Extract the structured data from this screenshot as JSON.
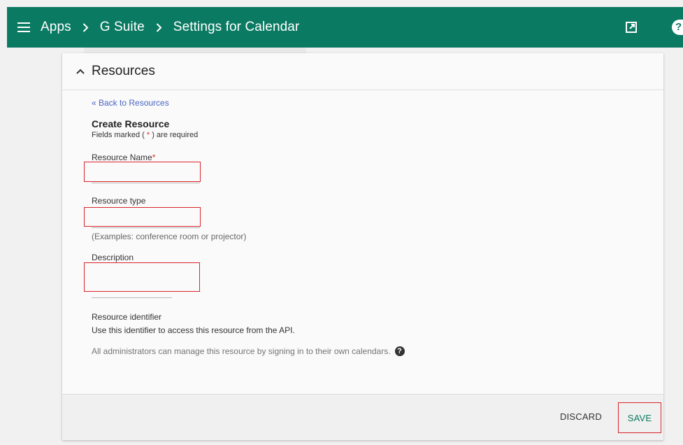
{
  "header": {
    "breadcrumbs": [
      "Apps",
      "G Suite",
      "Settings for Calendar"
    ],
    "help_glyph": "?"
  },
  "section": {
    "title": "Resources"
  },
  "form": {
    "back_link": "« Back to Resources",
    "title": "Create Resource",
    "required_note_prefix": "Fields marked ( ",
    "required_note_star": "*",
    "required_note_suffix": " ) are required",
    "fields": {
      "name": {
        "label": "Resource Name",
        "required_star": "*",
        "value": ""
      },
      "type": {
        "label": "Resource type",
        "value": "",
        "hint": "(Examples: conference room or projector)"
      },
      "description": {
        "label": "Description",
        "value": ""
      }
    },
    "resource_identifier": {
      "title": "Resource identifier",
      "description": "Use this identifier to access this resource from the API."
    },
    "admins_note": "All administrators can manage this resource by signing in to their own calendars.",
    "admins_help_glyph": "?"
  },
  "footer": {
    "discard_label": "DISCARD",
    "save_label": "SAVE"
  },
  "colors": {
    "header_bg": "#0b7a62",
    "link": "#4a66c4",
    "required": "#d93025",
    "highlight_border": "#d9242b"
  },
  "icons": {
    "menu": "hamburger-menu-icon",
    "breadcrumb_separator": "chevron-right-icon",
    "open_new": "open-in-new-icon",
    "help": "help-icon",
    "collapse": "chevron-up-icon"
  }
}
